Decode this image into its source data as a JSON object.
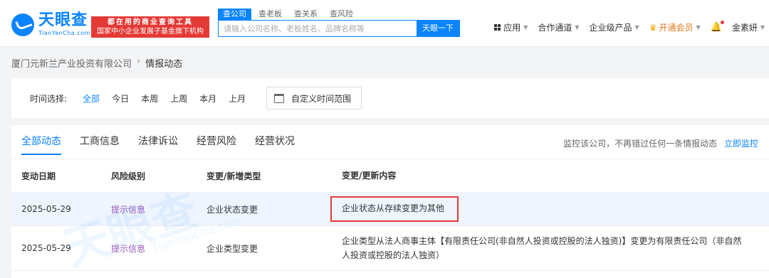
{
  "header": {
    "logo": {
      "cn": "天眼查",
      "en": "TianYanCha.com"
    },
    "slogan": {
      "line1": "都在用的商业查询工具",
      "line2": "国家中小企业发展子基金旗下机构"
    },
    "search_tabs": [
      "查公司",
      "查老板",
      "查关系",
      "查风险"
    ],
    "search": {
      "placeholder": "请输入公司名称、老板姓名、品牌名称等",
      "button": "天眼一下"
    },
    "nav": {
      "apps": "应用",
      "channel": "合作通道",
      "products": "企业级产品",
      "vip": "开通会员",
      "user": "金素妍"
    }
  },
  "breadcrumb": {
    "company": "厦门元新兰产业投资有限公司",
    "current": "情报动态"
  },
  "filter": {
    "label": "时间选择:",
    "options": [
      "全部",
      "今日",
      "本周",
      "上周",
      "本月",
      "上月"
    ],
    "custom_range": "自定义时间范围"
  },
  "tabs": [
    "全部动态",
    "工商信息",
    "法律诉讼",
    "经营风险",
    "经营状况"
  ],
  "monitor": {
    "text": "监控该公司，不再错过任何一条情报动态",
    "link": "立即监控"
  },
  "table": {
    "headers": [
      "变动日期",
      "风险级别",
      "变更/新增类型",
      "变更/更新内容"
    ],
    "rows": [
      {
        "date": "2025-05-29",
        "risk": "提示信息",
        "type": "企业状态变更",
        "content": "企业状态从存续变更为其他"
      },
      {
        "date": "2025-05-29",
        "risk": "提示信息",
        "type": "企业类型变更",
        "content": "企业类型从法人商事主体【有限责任公司(非自然人投资或控股的法人独资)】变更为有限责任公司（非自然人投资或控股的法人独资）"
      }
    ]
  },
  "watermark": {
    "cn": "天眼查",
    "en": "TianYanCha.com"
  },
  "colors": {
    "brand": "#0a84ff",
    "highlight_border": "#e53935",
    "risk": "#9b59b6",
    "vip": "#e0791d"
  }
}
